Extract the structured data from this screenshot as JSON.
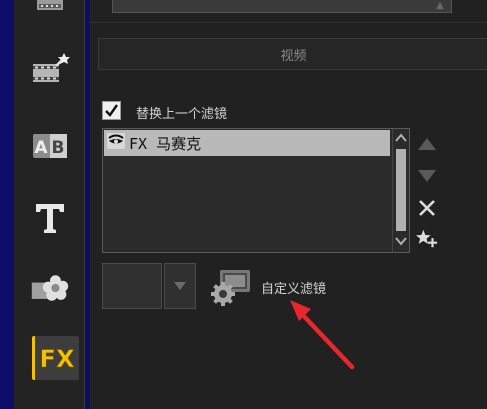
{
  "panel": {
    "section_tab": "视频",
    "replace_checkbox": {
      "label": "替换上一个滤镜",
      "checked": true
    },
    "filter_list": {
      "items": [
        {
          "label": "FX 马赛克",
          "selected": true
        }
      ]
    },
    "side_buttons": [
      "move-up-icon",
      "move-down-icon",
      "remove-icon",
      "favorite-add-icon"
    ],
    "custom_filter_label": "自定义滤镜"
  },
  "toolbar": {
    "items": [
      "media-icon",
      "instant-project-icon",
      "transition-icon",
      "title-icon",
      "graphic-icon",
      "filter-icon"
    ],
    "active": "filter-icon",
    "fx_text": "FX",
    "ab_text": "AB"
  },
  "colors": {
    "accent": "#f2c200",
    "annotation_arrow": "#e8262b"
  }
}
